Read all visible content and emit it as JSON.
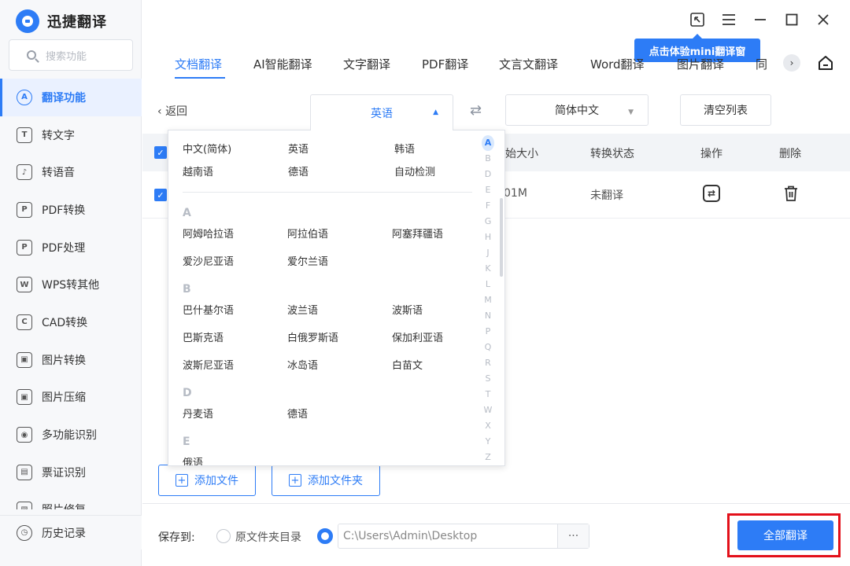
{
  "app": {
    "name": "迅捷翻译"
  },
  "search": {
    "placeholder": "搜索功能"
  },
  "sidebar": {
    "items": [
      {
        "label": "翻译功能",
        "icon": "translate-icon"
      },
      {
        "label": "转文字",
        "icon": "text-icon"
      },
      {
        "label": "转语音",
        "icon": "audio-icon"
      },
      {
        "label": "PDF转换",
        "icon": "pdf-convert-icon"
      },
      {
        "label": "PDF处理",
        "icon": "pdf-process-icon"
      },
      {
        "label": "WPS转其他",
        "icon": "wps-icon"
      },
      {
        "label": "CAD转换",
        "icon": "cad-icon"
      },
      {
        "label": "图片转换",
        "icon": "image-convert-icon"
      },
      {
        "label": "图片压缩",
        "icon": "image-compress-icon"
      },
      {
        "label": "多功能识别",
        "icon": "eye-icon"
      },
      {
        "label": "票证识别",
        "icon": "ticket-icon"
      },
      {
        "label": "照片修复",
        "icon": "photo-icon"
      }
    ],
    "history": "历史记录"
  },
  "tooltip": "点击体验mini翻译窗",
  "tabs": [
    "文档翻译",
    "AI智能翻译",
    "文字翻译",
    "PDF翻译",
    "文言文翻译",
    "Word翻译",
    "图片翻译",
    "同"
  ],
  "toolbar": {
    "back": "返回",
    "source_lang": "英语",
    "target_lang": "简体中文",
    "clear": "清空列表"
  },
  "table": {
    "headers": {
      "size": "始大小",
      "status": "转换状态",
      "op": "操作",
      "delete": "删除"
    },
    "row": {
      "size": "01M",
      "status": "未翻译"
    }
  },
  "dropdown": {
    "top": [
      "中文(简体)",
      "英语",
      "韩语",
      "越南语",
      "德语",
      "自动检测"
    ],
    "groups": [
      {
        "letter": "A",
        "items": [
          "阿姆哈拉语",
          "阿拉伯语",
          "阿塞拜疆语",
          "爱沙尼亚语",
          "爱尔兰语"
        ]
      },
      {
        "letter": "B",
        "items": [
          "巴什基尔语",
          "波兰语",
          "波斯语",
          "巴斯克语",
          "白俄罗斯语",
          "保加利亚语",
          "波斯尼亚语",
          "冰岛语",
          "白苗文"
        ]
      },
      {
        "letter": "D",
        "items": [
          "丹麦语",
          "德语"
        ]
      },
      {
        "letter": "E",
        "items": [
          "俄语"
        ]
      }
    ],
    "alphabet": [
      "A",
      "B",
      "D",
      "E",
      "F",
      "G",
      "H",
      "J",
      "K",
      "L",
      "M",
      "N",
      "P",
      "Q",
      "R",
      "S",
      "T",
      "W",
      "X",
      "Y",
      "Z"
    ],
    "alphabet_active": "A"
  },
  "buttons": {
    "add_file": "添加文件",
    "add_folder": "添加文件夹"
  },
  "bottom": {
    "save_to": "保存到:",
    "original_dir": "原文件夹目录",
    "path": "C:\\Users\\Admin\\Desktop",
    "more": "···",
    "translate_all": "全部翻译"
  },
  "colors": {
    "accent": "#2d7cf6",
    "highlight_frame": "#e3101a"
  }
}
